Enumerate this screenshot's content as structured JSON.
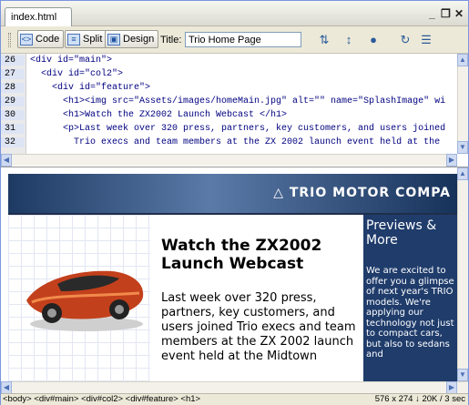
{
  "tab": {
    "title": "index.html"
  },
  "window_controls": {
    "minimize": "_",
    "restore": "ҙ",
    "close": "×"
  },
  "toolbar": {
    "code_label": "Code",
    "split_label": "Split",
    "design_label": "Design",
    "title_label": "Title:",
    "title_value": "Trio Home Page"
  },
  "code": {
    "lines": [
      {
        "num": "26",
        "text": "<div id=\"main\">"
      },
      {
        "num": "27",
        "text": "  <div id=\"col2\">"
      },
      {
        "num": "28",
        "text": "    <div id=\"feature\">"
      },
      {
        "num": "29",
        "text": "      <h1><img src=\"Assets/images/homeMain.jpg\" alt=\"\" name=\"SplashImage\" wi"
      },
      {
        "num": "30",
        "text": "      <h1>Watch the ZX2002 Launch Webcast </h1>"
      },
      {
        "num": "31",
        "text": "      <p>Last week over 320 press, partners, key customers, and users joined"
      },
      {
        "num": "32",
        "text": "        Trio execs and team members at the ZX 2002 launch event held at the"
      }
    ]
  },
  "design": {
    "brand": "TRIO MOTOR COMPA",
    "headline": "Watch the ZX2002 Launch Webcast",
    "body": "Last week over 320 press, partners, key customers, and users joined Trio execs and team members at the ZX 2002 launch event held at the Midtown",
    "sidebar_title": "Previews & More",
    "sidebar_body": "We are excited to offer you a glimpse of next year's TRIO models. We're applying our technology not just to compact cars, but also to sedans and"
  },
  "status": {
    "tag_path": "<body> <div#main> <div#col2> <div#feature> <h1>",
    "info": "576 x 274 ↓ 20K / 3 sec"
  }
}
